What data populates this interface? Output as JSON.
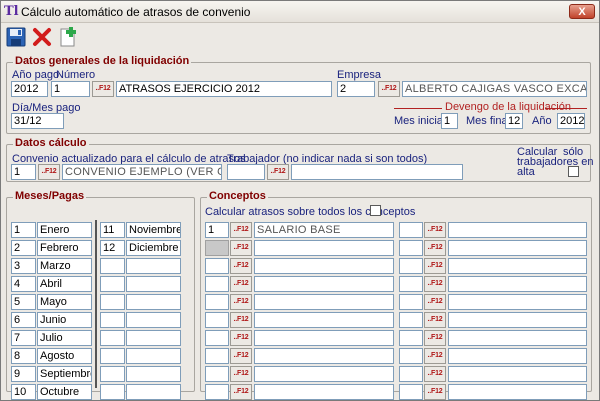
{
  "window": {
    "title": "Cálculo automático de atrasos de convenio",
    "close_label": "X",
    "app_icon": "Tl"
  },
  "toolbar": {
    "save_icon": "save-icon",
    "delete_icon": "delete-icon",
    "new_icon": "new-document-icon"
  },
  "general": {
    "group_title": "Datos generales de la liquidación",
    "anio_label": "Año pago",
    "anio_value": "2012",
    "numero_label": "Número",
    "numero_value": "1",
    "f12": "..F12",
    "descripcion_value": "ATRASOS EJERCICIO 2012",
    "empresa_label": "Empresa",
    "empresa_value": "2",
    "empresa_nombre": "ALBERTO CAJIGAS VASCO EXCAVACIO",
    "dia_mes_label": "Día/Mes pago",
    "dia_mes_value": "31/12",
    "devengo_label": "Devengo de la liquidación",
    "mes_inicial_label": "Mes inicial",
    "mes_inicial_value": "1",
    "mes_final_label": "Mes final",
    "mes_final_value": "12",
    "anio2_label": "Año",
    "anio2_value": "2012"
  },
  "calculo": {
    "group_title": "Datos cálculo",
    "convenio_label": "Convenio actualizado para el cálculo de atrasos",
    "convenio_value": "1",
    "convenio_nombre": "CONVENIO EJEMPLO (VER OBSERVA",
    "trabajador_label": "Trabajador (no indicar nada si son todos)",
    "trabajador_value": "",
    "calcular_label_1": "Calcular",
    "calcular_label_2": "sólo",
    "calcular_label_3": "trabajadores en",
    "calcular_label_4": "alta"
  },
  "meses": {
    "group_title": "Meses/Pagas",
    "left": [
      {
        "num": "1",
        "name": "Enero"
      },
      {
        "num": "2",
        "name": "Febrero"
      },
      {
        "num": "3",
        "name": "Marzo"
      },
      {
        "num": "4",
        "name": "Abril"
      },
      {
        "num": "5",
        "name": "Mayo"
      },
      {
        "num": "6",
        "name": "Junio"
      },
      {
        "num": "7",
        "name": "Julio"
      },
      {
        "num": "8",
        "name": "Agosto"
      },
      {
        "num": "9",
        "name": "Septiembre"
      },
      {
        "num": "10",
        "name": "Octubre"
      }
    ],
    "right": [
      {
        "num": "11",
        "name": "Noviembre"
      },
      {
        "num": "12",
        "name": "Diciembre"
      },
      {
        "num": "",
        "name": ""
      },
      {
        "num": "",
        "name": ""
      },
      {
        "num": "",
        "name": ""
      },
      {
        "num": "",
        "name": ""
      },
      {
        "num": "",
        "name": ""
      },
      {
        "num": "",
        "name": ""
      },
      {
        "num": "",
        "name": ""
      },
      {
        "num": "",
        "name": ""
      }
    ]
  },
  "conceptos": {
    "group_title": "Conceptos",
    "todos_label": "Calcular atrasos sobre todos los conceptos",
    "left": [
      {
        "code": "1",
        "name": "SALARIO BASE"
      },
      {
        "code": "",
        "name": ""
      },
      {
        "code": "",
        "name": ""
      },
      {
        "code": "",
        "name": ""
      },
      {
        "code": "",
        "name": ""
      },
      {
        "code": "",
        "name": ""
      },
      {
        "code": "",
        "name": ""
      },
      {
        "code": "",
        "name": ""
      },
      {
        "code": "",
        "name": ""
      },
      {
        "code": "",
        "name": ""
      }
    ],
    "right": [
      {
        "code": "",
        "name": ""
      },
      {
        "code": "",
        "name": ""
      },
      {
        "code": "",
        "name": ""
      },
      {
        "code": "",
        "name": ""
      },
      {
        "code": "",
        "name": ""
      },
      {
        "code": "",
        "name": ""
      },
      {
        "code": "",
        "name": ""
      },
      {
        "code": "",
        "name": ""
      },
      {
        "code": "",
        "name": ""
      },
      {
        "code": "",
        "name": ""
      }
    ]
  }
}
